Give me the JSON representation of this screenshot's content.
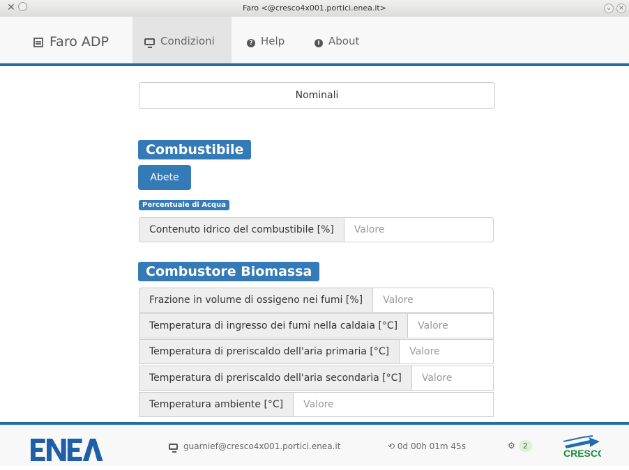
{
  "window": {
    "title": "Faro <@cresco4x001.portici.enea.it>"
  },
  "navbar": {
    "brand": "Faro ADP",
    "items": [
      {
        "label": "Condizioni",
        "icon": "monitor-icon",
        "active": true
      },
      {
        "label": "Help",
        "icon": "question-circle-icon"
      },
      {
        "label": "About",
        "icon": "info-circle-icon"
      }
    ]
  },
  "main": {
    "mode_label": "Nominali",
    "combustibile": {
      "title": "Combustibile",
      "fuel_button": "Abete",
      "water_label": "Percentuale di Acqua",
      "fields": [
        {
          "label": "Contenuto idrico del combustibile [%]",
          "placeholder": "Valore"
        }
      ]
    },
    "combustore": {
      "title": "Combustore Biomassa",
      "fields": [
        {
          "label": "Frazione in volume di ossigeno nei fumi [%]",
          "placeholder": "Valore"
        },
        {
          "label": "Temperatura di ingresso dei fumi nella caldaia [°C]",
          "placeholder": "Valore"
        },
        {
          "label": "Temperatura di preriscaldo dell'aria primaria [°C]",
          "placeholder": "Valore"
        },
        {
          "label": "Temperatura di preriscaldo dell'aria secondaria [°C]",
          "placeholder": "Valore"
        },
        {
          "label": "Temperatura ambiente [°C]",
          "placeholder": "Valore"
        }
      ]
    }
  },
  "footer": {
    "logo_text": "ENEA",
    "user": "guarnief@cresco4x001.portici.enea.it",
    "elapsed": "0d 00h 01m 45s",
    "jobs_count": "2",
    "cresco_logo": "CRESCO"
  },
  "colors": {
    "accent": "#337ab7",
    "nav_border": "#1f6ea9",
    "enea_blue": "#1f5fa8"
  }
}
